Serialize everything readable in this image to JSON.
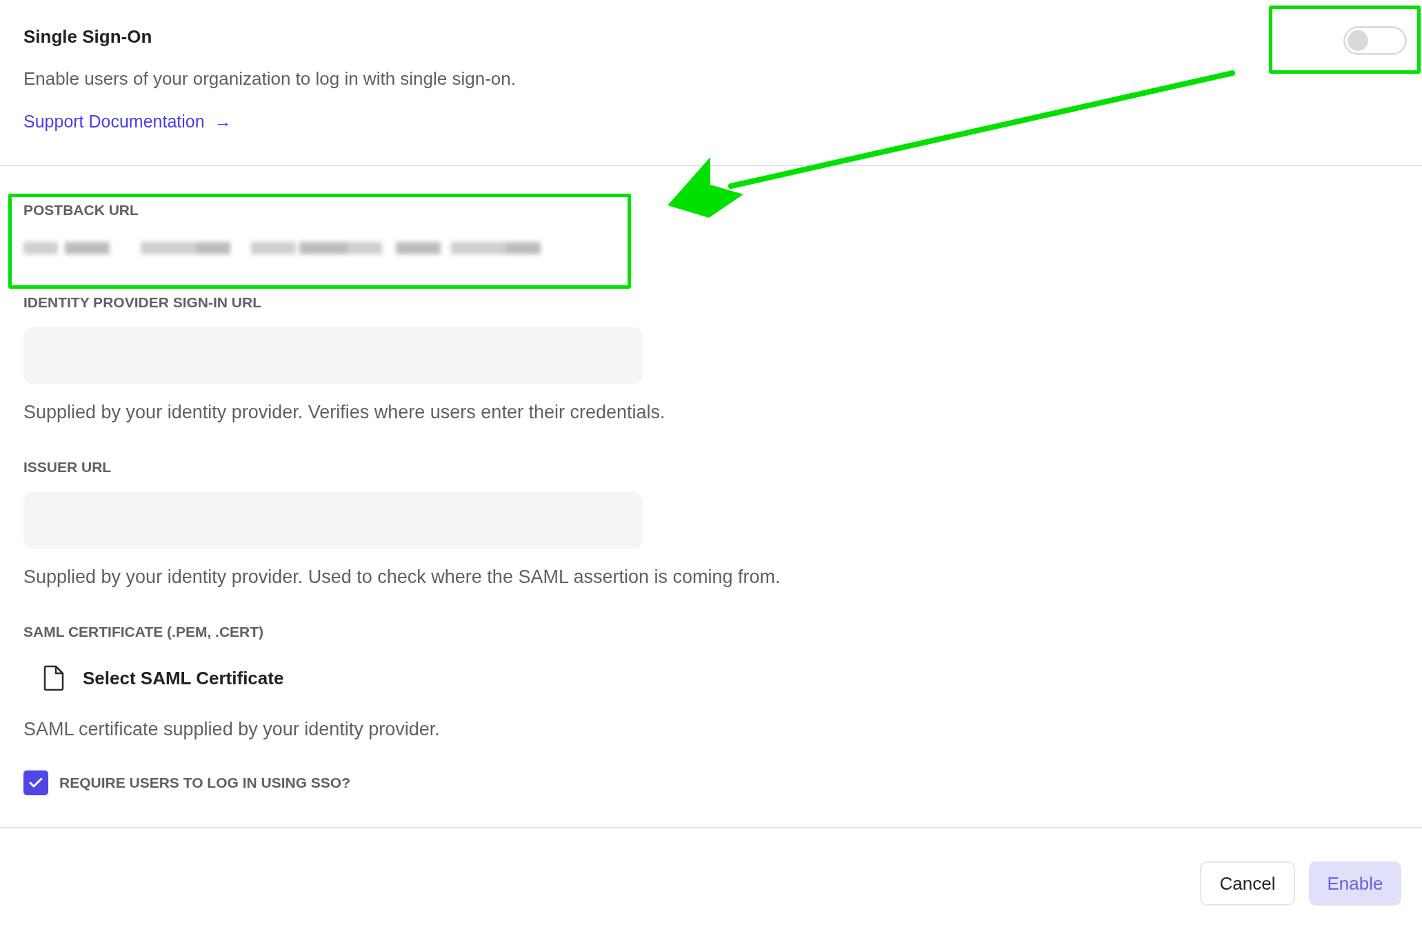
{
  "header": {
    "title": "Single Sign-On",
    "description": "Enable users of your organization to log in with single sign-on.",
    "link": "Support Documentation",
    "link_icon": "→",
    "toggle": {
      "on": false
    }
  },
  "fields": [
    {
      "kind": "redacted",
      "label": "POSTBACK URL"
    },
    {
      "kind": "input",
      "label": "IDENTITY PROVIDER SIGN-IN URL",
      "help": "Supplied by your identity provider. Verifies where users enter their credentials."
    },
    {
      "kind": "input",
      "label": "ISSUER URL",
      "help": "Supplied by your identity provider. Used to check where the SAML assertion is coming from."
    },
    {
      "kind": "file",
      "label": "SAML CERTIFICATE (.PEM, .CERT)",
      "button": "Select SAML Certificate",
      "help": "SAML certificate supplied by your identity provider."
    }
  ],
  "require_sso": {
    "label": "REQUIRE USERS TO LOG IN USING SSO?",
    "checked": true
  },
  "buttons": [
    {
      "label": "Cancel",
      "kind": "secondary",
      "disabled": false
    },
    {
      "label": "Enable",
      "kind": "primary",
      "disabled": true
    }
  ]
}
